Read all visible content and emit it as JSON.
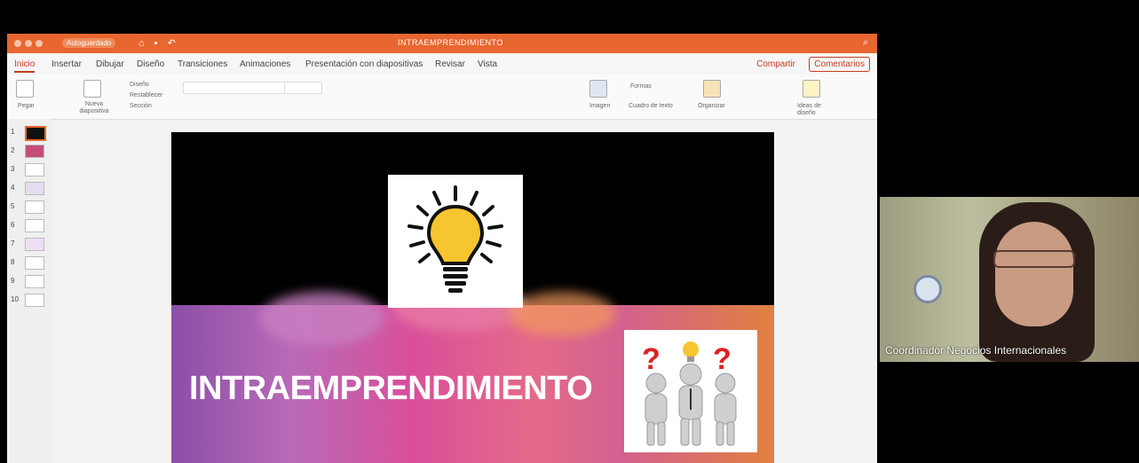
{
  "powerpoint": {
    "title_bar": {
      "autosave": "Autoguardado",
      "document_title": "INTRAEMPRENDIMIENTO"
    },
    "tabs": [
      "Inicio",
      "Insertar",
      "Dibujar",
      "Diseño",
      "Transiciones",
      "Animaciones",
      "Presentación con diapositivas",
      "Revisar",
      "Vista"
    ],
    "active_tab": "Inicio",
    "share_label": "Compartir",
    "comments_label": "Comentarios",
    "ribbon": {
      "paste": "Pegar",
      "new_slide": "Nueva diapositiva",
      "layout": "Diseño",
      "reset": "Restablecer",
      "section": "Sección",
      "image": "Imagen",
      "shapes": "Formas",
      "text_box": "Cuadro de texto",
      "arrange": "Organizar",
      "design_ideas": "Ideas de diseño"
    },
    "slide_numbers": [
      "1",
      "2",
      "3",
      "4",
      "5",
      "6",
      "7",
      "8",
      "9",
      "10"
    ],
    "selected_slide": "1",
    "slide": {
      "title": "INTRAEMPRENDIMIENTO"
    }
  },
  "participant": {
    "name": "Coordinador Negocios Internacionales"
  },
  "colors": {
    "accent": "#e8662f",
    "ribbon_accent": "#c43e1c",
    "bulb": "#f7c530"
  }
}
